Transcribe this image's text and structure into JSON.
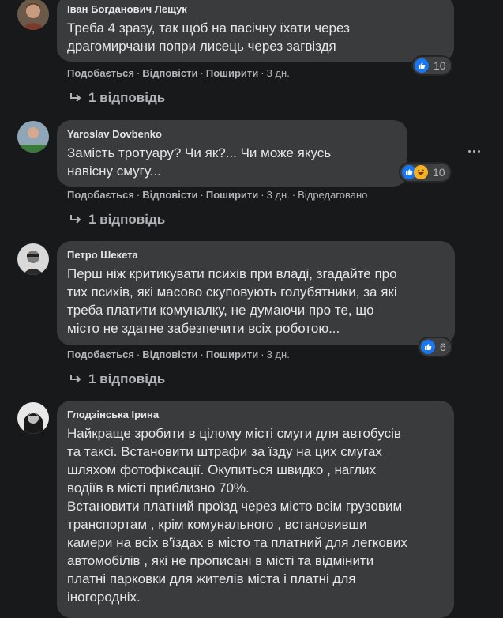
{
  "comments": [
    {
      "author": "Іван Богданович Лещук",
      "lines": [
        "Треба 4 зразу, так щоб на пасічну їхати через",
        "драгомирчани попри лисець через загвіздя"
      ],
      "like": "Подобається",
      "reply": "Відповісти",
      "share": "Поширити",
      "time": "3 дн.",
      "edited": "",
      "reactions": [
        "like"
      ],
      "reaction_count": "10",
      "replies": "1 відповідь"
    },
    {
      "author": "Yaroslav Dovbenko",
      "lines": [
        "Замість тротуару? Чи як?... Чи може якусь",
        "навісну смугу..."
      ],
      "like": "Подобається",
      "reply": "Відповісти",
      "share": "Поширити",
      "time": "3 дн.",
      "edited": "Відредаговано",
      "reactions": [
        "like",
        "haha"
      ],
      "reaction_count": "10",
      "replies": "1 відповідь"
    },
    {
      "author": "Петро Шекета",
      "lines": [
        "Перш ніж критикувати психів при владі, згадайте про",
        "тих психів, які масово скуповують голубятники, за які",
        "треба платити комуналку, не думаючи про те, що",
        "місто не здатне забезпечити всіх роботою..."
      ],
      "like": "Подобається",
      "reply": "Відповісти",
      "share": "Поширити",
      "time": "3 дн.",
      "edited": "",
      "reactions": [
        "like"
      ],
      "reaction_count": "6",
      "replies": "1 відповідь"
    },
    {
      "author": "Глодзінська Ірина",
      "lines": [
        "Найкраще зробити в цілому місті смуги для автобусів",
        "та таксі. Встановити штрафи за їзду на цих смугах",
        "шляхом фотофіксації. Окупиться швидко , наглих",
        "водіїв в місті приблизно 70%.",
        "Встановити платний проїзд через місто всім грузовим",
        "транспортам , крім комунального , встановивши",
        "камери на всіх в'їздах в місто та платний для легкових",
        "автомобілів , які не прописані в місті та відмінити",
        "платні парковки для жителів міста і платні для",
        "іногородніх."
      ]
    }
  ],
  "colors": {
    "like": "#1877f2",
    "haha": "#f7b125",
    "bubble": "#3a3b3c",
    "bg": "#18191a"
  },
  "icons": {
    "reply_arrow": "reply-arrow-icon",
    "more": "more-options-icon"
  }
}
